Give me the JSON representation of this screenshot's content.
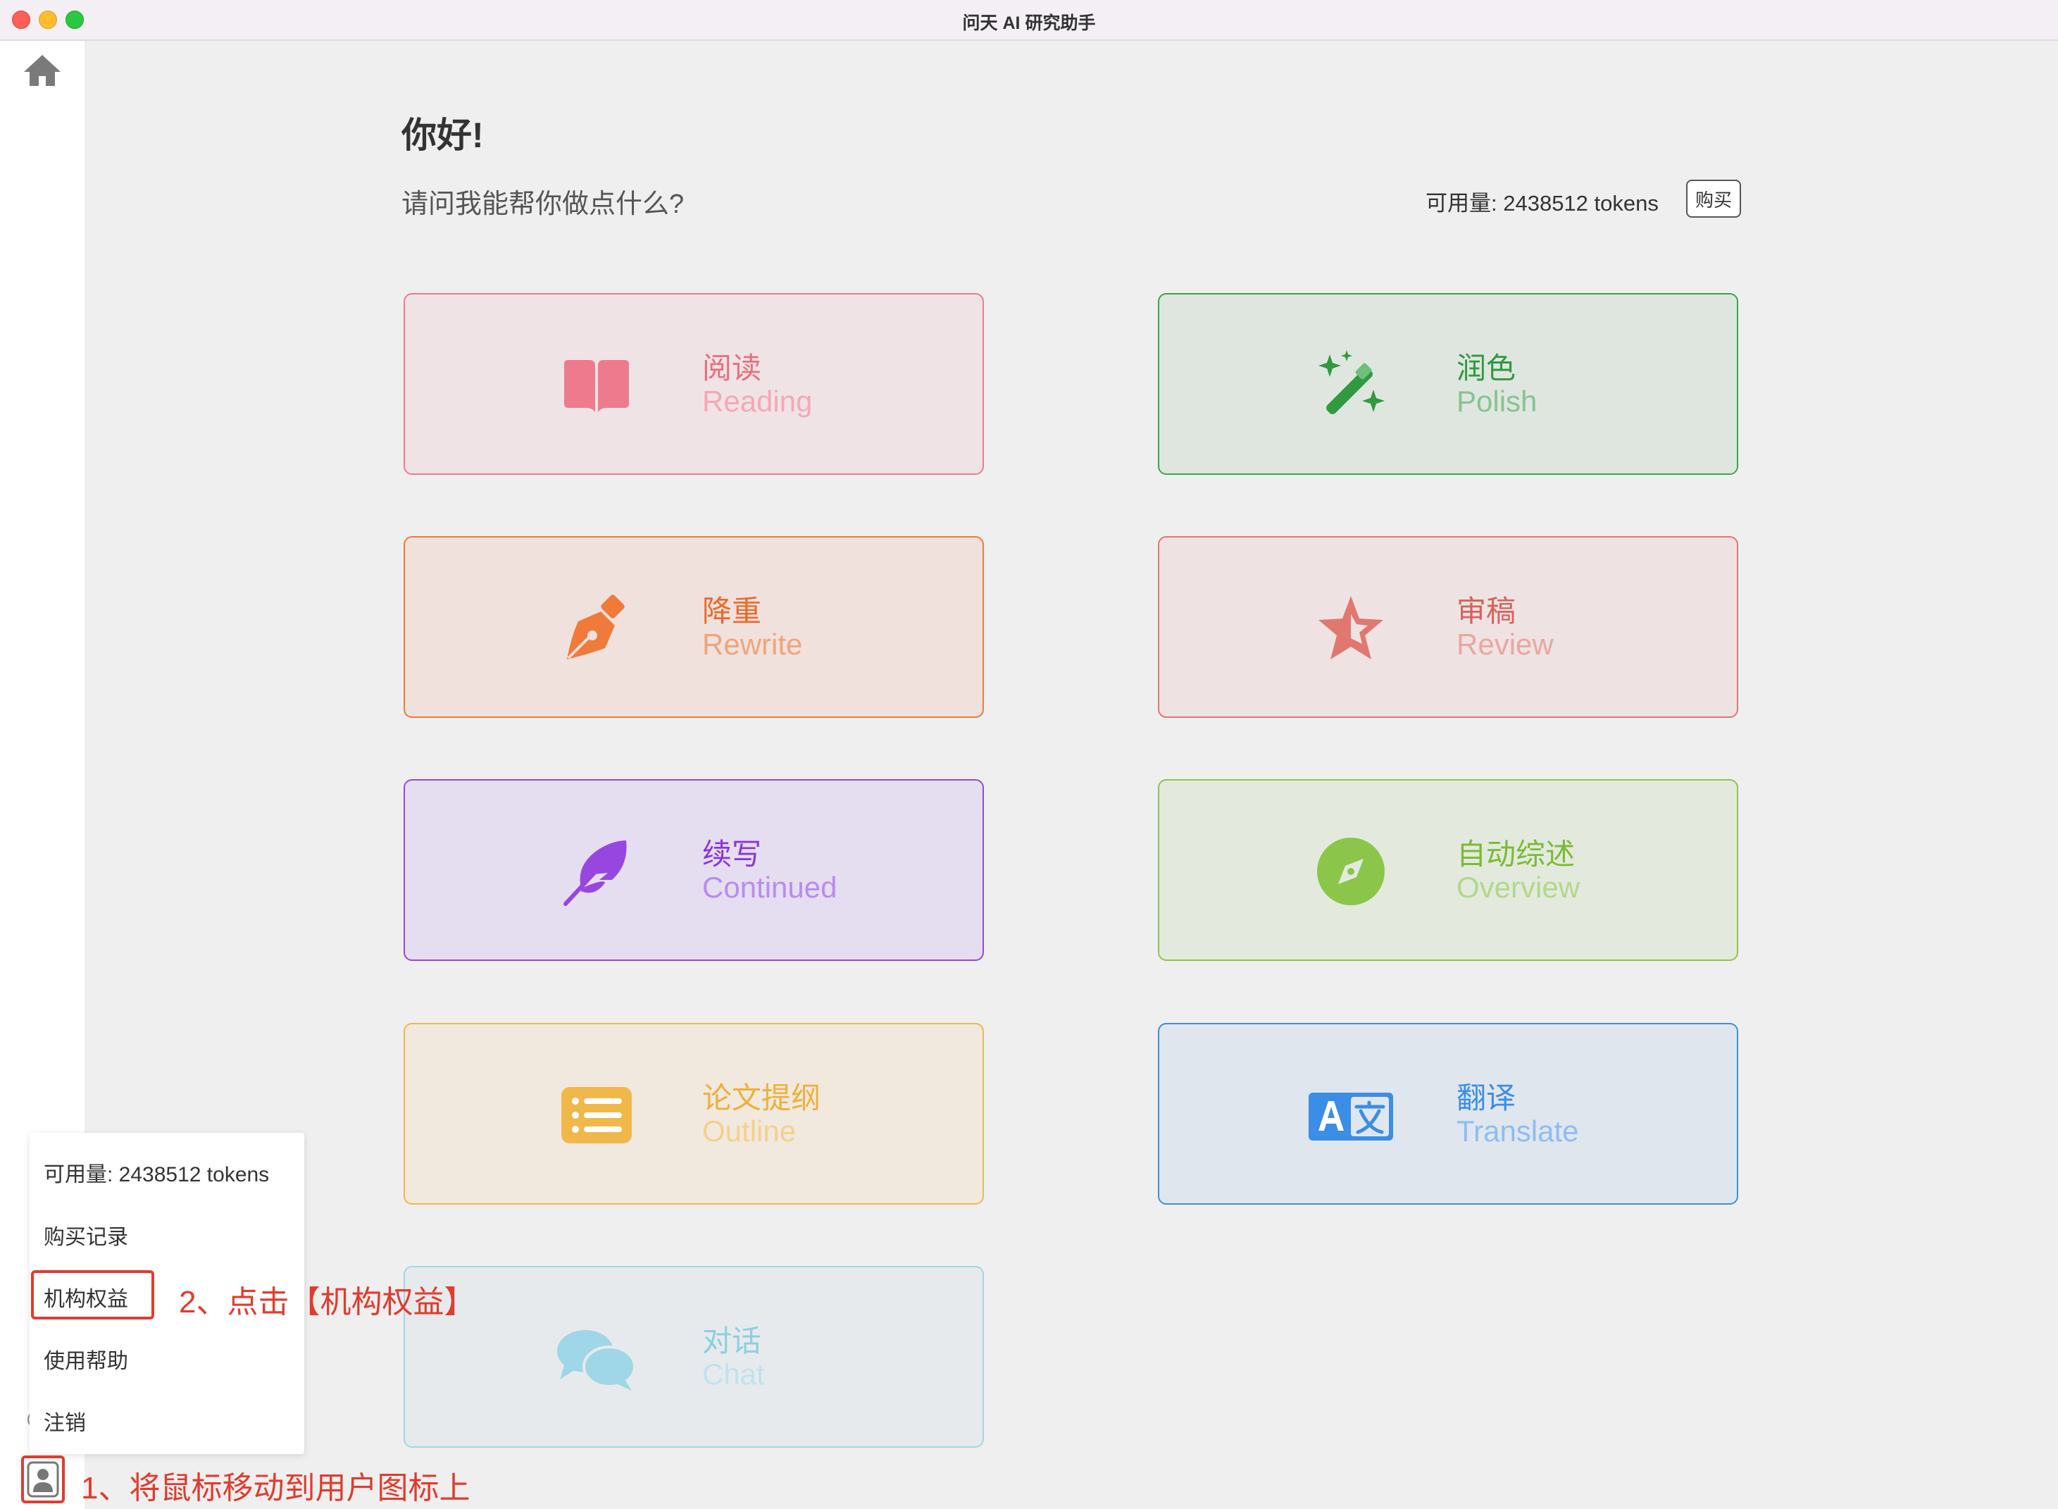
{
  "window": {
    "title": "问天 AI 研究助手"
  },
  "header": {
    "greeting": "你好!",
    "subtitle": "请问我能帮你做点什么?",
    "quota": "可用量: 2438512 tokens",
    "buy_label": "购买"
  },
  "cards": [
    {
      "cn": "阅读",
      "en": "Reading",
      "icon": "book-icon",
      "title_color": "#e8707f",
      "sub_color": "#f4a9b5"
    },
    {
      "cn": "润色",
      "en": "Polish",
      "icon": "magic-wand-icon",
      "title_color": "#2f9a3f",
      "sub_color": "#86c48f"
    },
    {
      "cn": "降重",
      "en": "Rewrite",
      "icon": "pen-nib-icon",
      "title_color": "#ec6a29",
      "sub_color": "#f0a47c"
    },
    {
      "cn": "审稿",
      "en": "Review",
      "icon": "star-icon",
      "title_color": "#d4645c",
      "sub_color": "#e8a7a2"
    },
    {
      "cn": "续写",
      "en": "Continued",
      "icon": "feather-icon",
      "title_color": "#8a37dc",
      "sub_color": "#b98cec"
    },
    {
      "cn": "自动综述",
      "en": "Overview",
      "icon": "compass-icon",
      "title_color": "#7bbb38",
      "sub_color": "#b2d88a"
    },
    {
      "cn": "论文提纲",
      "en": "Outline",
      "icon": "list-icon",
      "title_color": "#eeb03c",
      "sub_color": "#f3d18b"
    },
    {
      "cn": "翻译",
      "en": "Translate",
      "icon": "translate-icon",
      "title_color": "#3a8ee6",
      "sub_color": "#8dbdf1"
    },
    {
      "cn": "对话",
      "en": "Chat",
      "icon": "chat-bubbles-icon",
      "title_color": "#8ccfe2",
      "sub_color": "#bfe3ee"
    }
  ],
  "user_menu": {
    "quota": "可用量: 2438512 tokens",
    "purchases": "购买记录",
    "org_rights": "机构权益",
    "help": "使用帮助",
    "logout": "注销"
  },
  "annotations": {
    "step1": "1、将鼠标移动到用户图标上",
    "step2": "2、点击【机构权益】"
  },
  "colors": {
    "accent_red": "#e03c2e"
  }
}
